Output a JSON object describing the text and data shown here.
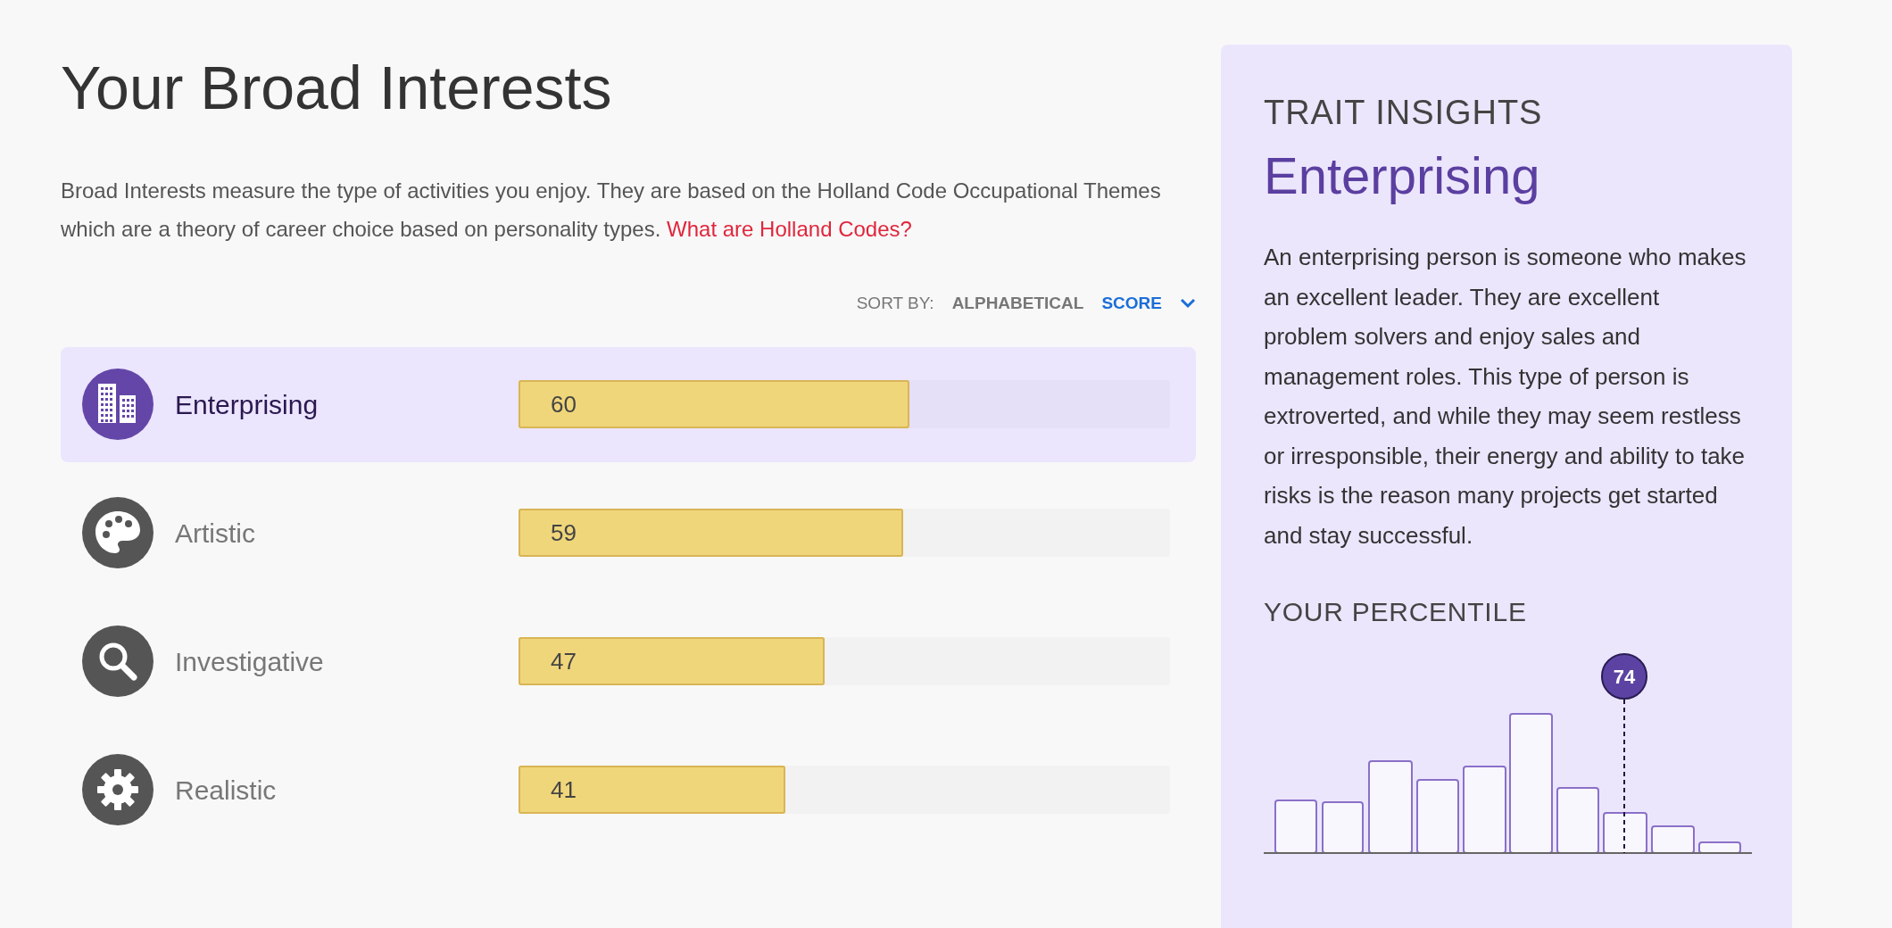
{
  "heading": "Your Broad Interests",
  "intro": {
    "text": "Broad Interests measure the type of activities you enjoy. They are based on the Holland Code Occupational Themes which are a theory of career choice based on personality types.",
    "link": "What are Holland Codes?"
  },
  "sort": {
    "label": "SORT BY:",
    "options": [
      {
        "label": "ALPHABETICAL",
        "selected": false
      },
      {
        "label": "SCORE",
        "selected": true
      }
    ]
  },
  "interests": [
    {
      "name": "Enterprising",
      "score": "60",
      "level": 0.6,
      "selected": true
    },
    {
      "name": "Artistic",
      "score": "59",
      "level": 0.59,
      "selected": false
    },
    {
      "name": "Investigative",
      "score": "47",
      "level": 0.47,
      "selected": false
    },
    {
      "name": "Realistic",
      "score": "41",
      "level": 0.41,
      "selected": false
    }
  ],
  "insights": {
    "label": "TRAIT INSIGHTS",
    "title": "Enterprising",
    "description": "An enterprising person is someone who makes an excellent leader. They are excellent problem solvers and enjoy sales and management roles. This type of person is extroverted, and while they may seem restless or irresponsible, their energy and ability to take risks is the reason many projects get started and stay successful.",
    "percentile_label": "YOUR PERCENTILE",
    "percentile": "74"
  }
}
